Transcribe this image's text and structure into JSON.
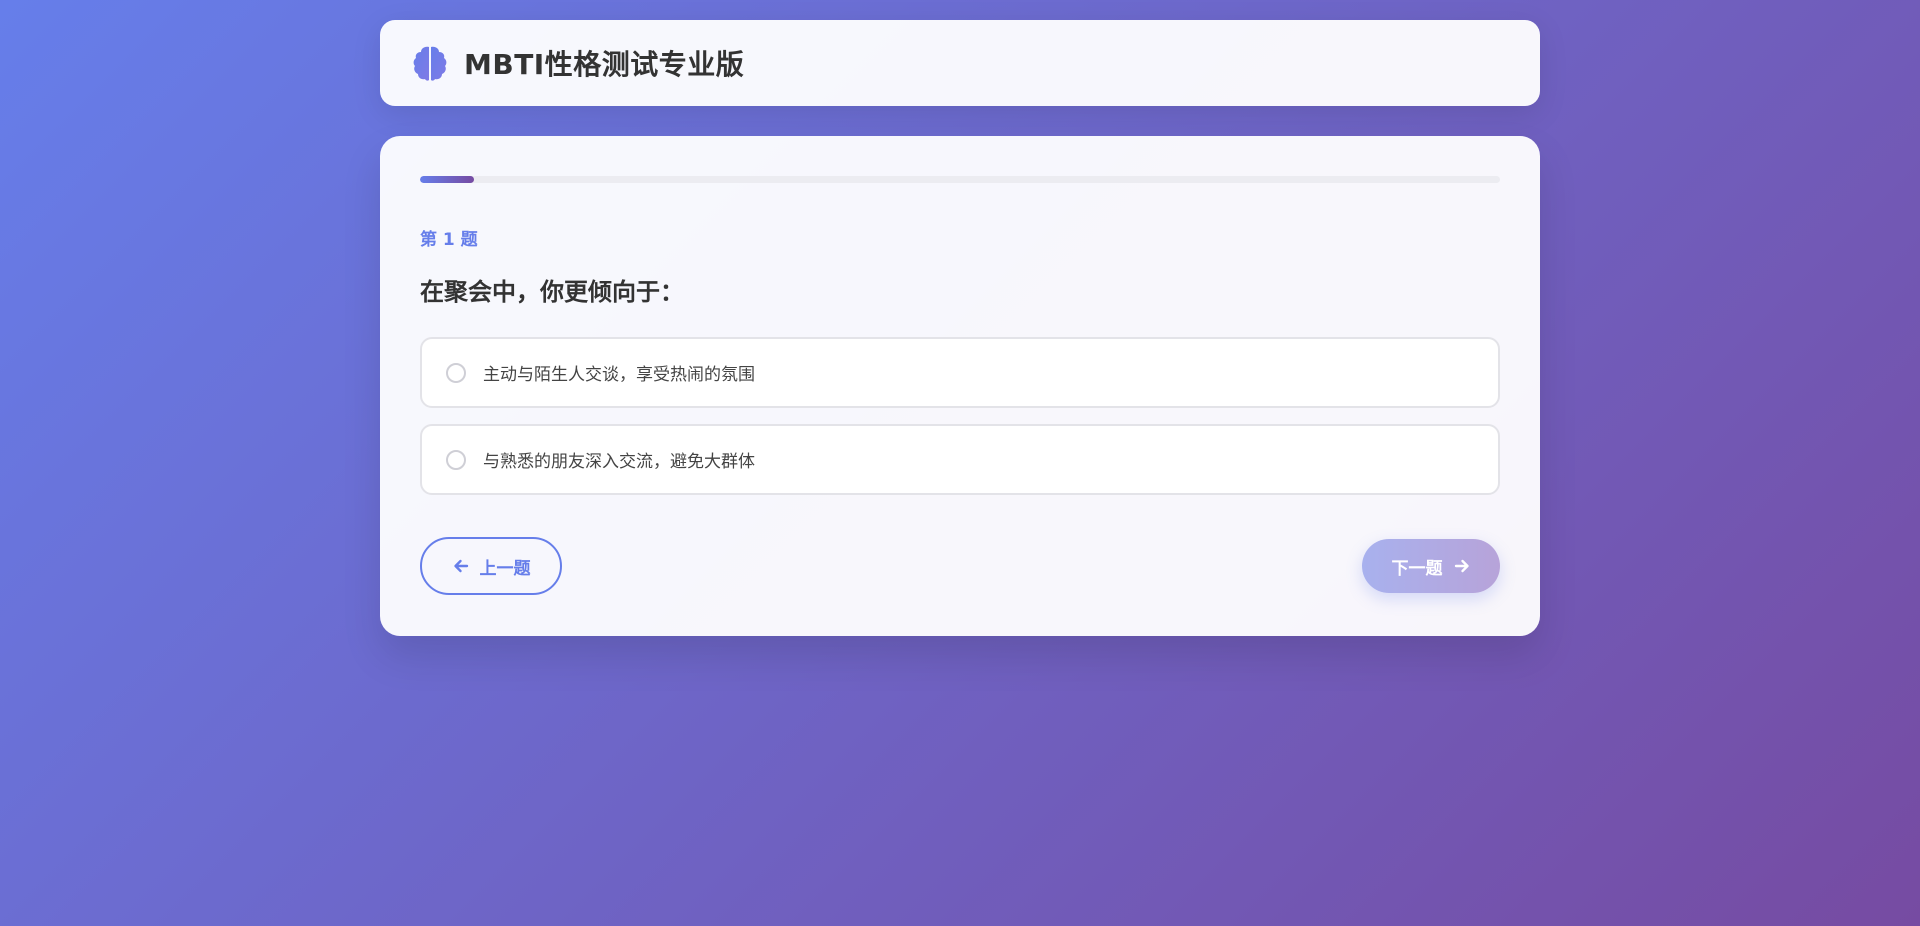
{
  "header": {
    "title": "MBTI性格测试专业版",
    "icon": "brain-icon"
  },
  "colors": {
    "accent": "#667eea",
    "accent_end": "#764ba2",
    "text": "#333333"
  },
  "quiz": {
    "progress_fraction": 0.05,
    "question_number": "第 1 题",
    "question_text": "在聚会中，你更倾向于：",
    "options": [
      {
        "label": "主动与陌生人交谈，享受热闹的氛围",
        "selected": false
      },
      {
        "label": "与熟悉的朋友深入交流，避免大群体",
        "selected": false
      }
    ]
  },
  "nav": {
    "prev_label": "上一题",
    "prev_icon": "arrow-left-icon",
    "next_label": "下一题",
    "next_icon": "arrow-right-icon",
    "next_disabled": true
  }
}
